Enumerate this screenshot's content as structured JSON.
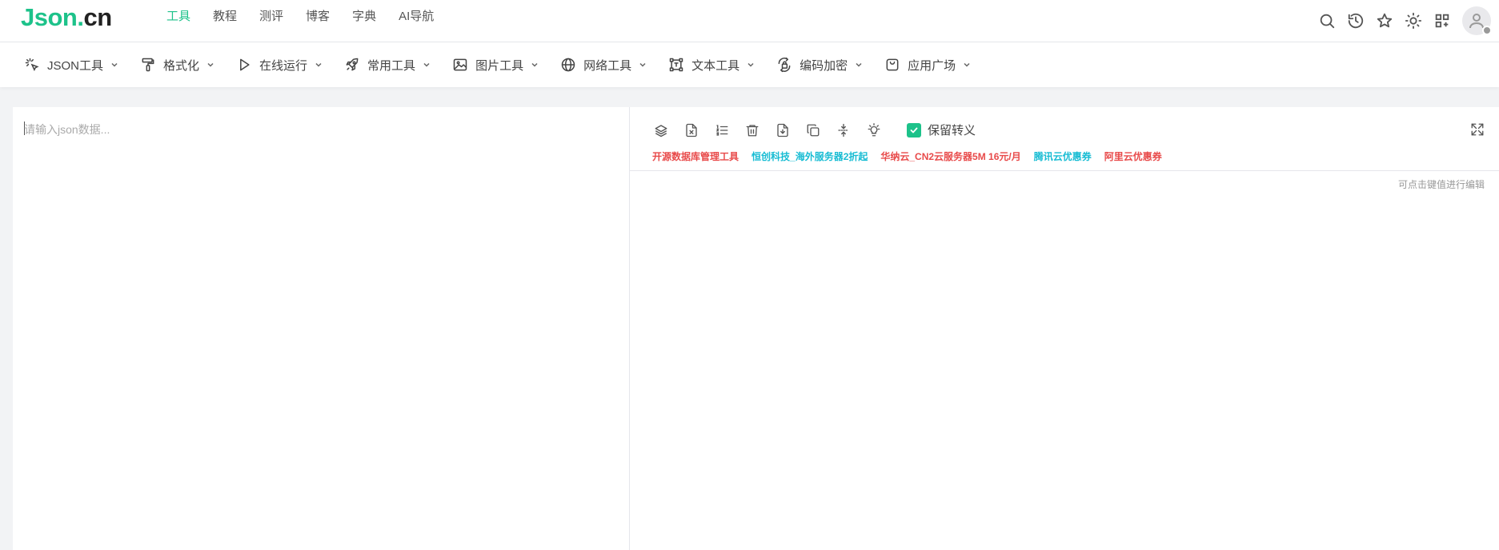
{
  "logo": {
    "part1": "Json.",
    "part2": "cn"
  },
  "main_nav": [
    {
      "label": "工具",
      "active": true
    },
    {
      "label": "教程"
    },
    {
      "label": "测评"
    },
    {
      "label": "博客"
    },
    {
      "label": "字典"
    },
    {
      "label": "AI导航"
    }
  ],
  "top_actions": [
    "search-icon",
    "history-icon",
    "star-icon",
    "theme-sun-icon",
    "apps-icon",
    "user-avatar"
  ],
  "tool_menus": [
    {
      "label": "JSON工具",
      "icon": "sparkle-cursor-icon"
    },
    {
      "label": "格式化",
      "icon": "paint-roller-icon"
    },
    {
      "label": "在线运行",
      "icon": "play-icon"
    },
    {
      "label": "常用工具",
      "icon": "rocket-icon"
    },
    {
      "label": "图片工具",
      "icon": "image-icon"
    },
    {
      "label": "网络工具",
      "icon": "globe-icon"
    },
    {
      "label": "文本工具",
      "icon": "text-box-icon"
    },
    {
      "label": "编码加密",
      "icon": "encode-lock-icon"
    },
    {
      "label": "应用广场",
      "icon": "shopping-bag-icon"
    }
  ],
  "editor": {
    "placeholder": "请输入json数据..."
  },
  "right_toolbar": {
    "icons": [
      "layers-icon",
      "file-excel-icon",
      "ordered-list-icon",
      "trash-icon",
      "file-download-icon",
      "copy-icon",
      "compress-icon",
      "bulb-icon"
    ],
    "checkbox_label": "保留转义",
    "checkbox_checked": true
  },
  "ads": [
    {
      "text": "开源数据库管理工具",
      "color": "#e84a4a"
    },
    {
      "text": "恒创科技_海外服务器2折起",
      "color": "#17bcd3"
    },
    {
      "text": "华纳云_CN2云服务器5M 16元/月",
      "color": "#e84a4a"
    },
    {
      "text": "腾讯云优惠券",
      "color": "#17bcd3"
    },
    {
      "text": "阿里云优惠券",
      "color": "#e84a4a"
    }
  ],
  "output": {
    "hint": "可点击键值进行编辑"
  },
  "colors": {
    "brand": "#1dc28a",
    "ad_red": "#e84a4a",
    "ad_cyan": "#17bcd3"
  }
}
